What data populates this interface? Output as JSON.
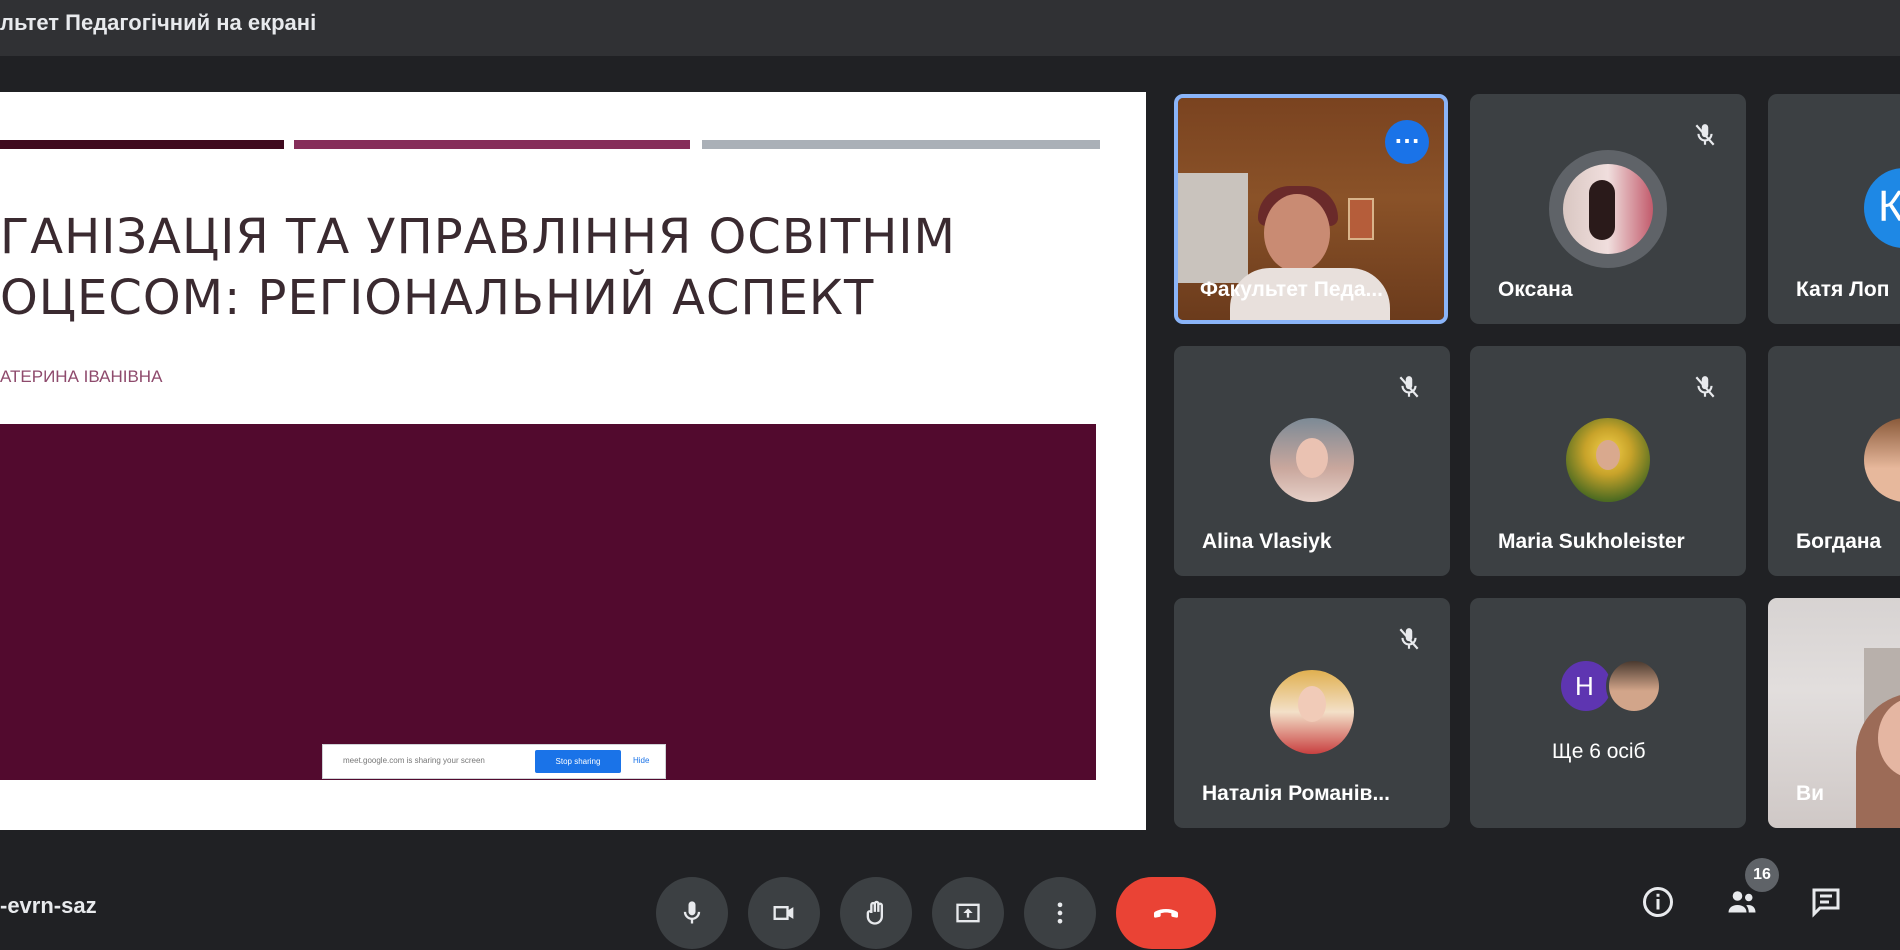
{
  "header": {
    "title": "льтет Педагогічний на екрані"
  },
  "slide": {
    "title_line1": "ГАНІЗАЦІЯ ТА УПРАВЛІННЯ ОСВІТНІМ",
    "title_line2": "ОЦЕСОМ: РЕГІОНАЛЬНИЙ АСПЕКТ",
    "author": "АТЕРИНА ІВАНІВНА",
    "notification": {
      "text": "meet.google.com is sharing your screen",
      "button": "Stop sharing",
      "hide": "Hide"
    }
  },
  "participants": [
    {
      "name": "Факультет Педа...",
      "more_icon": "more-horiz-icon"
    },
    {
      "name": "Оксана",
      "muted": true
    },
    {
      "name": "Катя Лоп",
      "initial": "К",
      "muted": true
    },
    {
      "name": "Alina Vlasiyk",
      "muted": true
    },
    {
      "name": "Maria Sukholeister",
      "muted": true
    },
    {
      "name": "Богдана",
      "muted": true
    },
    {
      "name": "Наталія Романів...",
      "muted": true
    },
    {
      "name": "Ще 6 осіб",
      "initial": "Н"
    },
    {
      "name": "Ви"
    }
  ],
  "footer": {
    "meeting_code": "-evrn-saz",
    "participant_count": "16",
    "controls": [
      "mic-icon",
      "camera-icon",
      "raise-hand-icon",
      "present-icon",
      "more-vert-icon",
      "end-call-icon"
    ],
    "right_icons": [
      "info-icon",
      "people-icon",
      "chat-icon"
    ]
  },
  "colors": {
    "end_call": "#ea4335",
    "accent": "#1a73e8",
    "active_border": "#8ab4f8",
    "slide_panel": "#520a2e"
  }
}
